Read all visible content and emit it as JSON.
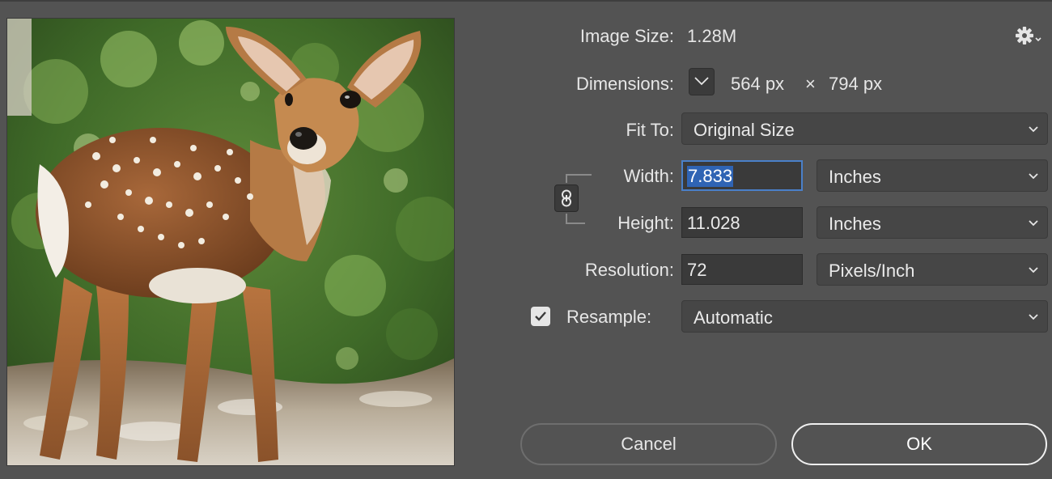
{
  "info": {
    "image_size_label": "Image Size:",
    "image_size_value": "1.28M",
    "dimensions_label": "Dimensions:",
    "dimensions_width": "564 px",
    "dimensions_times": "×",
    "dimensions_height": "794 px"
  },
  "fit_to": {
    "label": "Fit To:",
    "selected": "Original Size"
  },
  "width": {
    "label": "Width:",
    "value": "7.833",
    "unit": "Inches"
  },
  "height": {
    "label": "Height:",
    "value": "11.028",
    "unit": "Inches"
  },
  "resolution": {
    "label": "Resolution:",
    "value": "72",
    "unit": "Pixels/Inch"
  },
  "resample": {
    "label": "Resample:",
    "checked": true,
    "selected": "Automatic"
  },
  "buttons": {
    "cancel": "Cancel",
    "ok": "OK"
  },
  "icons": {
    "settings": "gear-icon",
    "dimensions_toggle": "chevron-down-icon",
    "constrain": "chain-link-icon",
    "dropdown": "chevron-down-icon",
    "check": "checkmark-icon"
  },
  "colors": {
    "background": "#535353",
    "selection": "#2f64b4",
    "focus_border": "#4a80c9"
  }
}
